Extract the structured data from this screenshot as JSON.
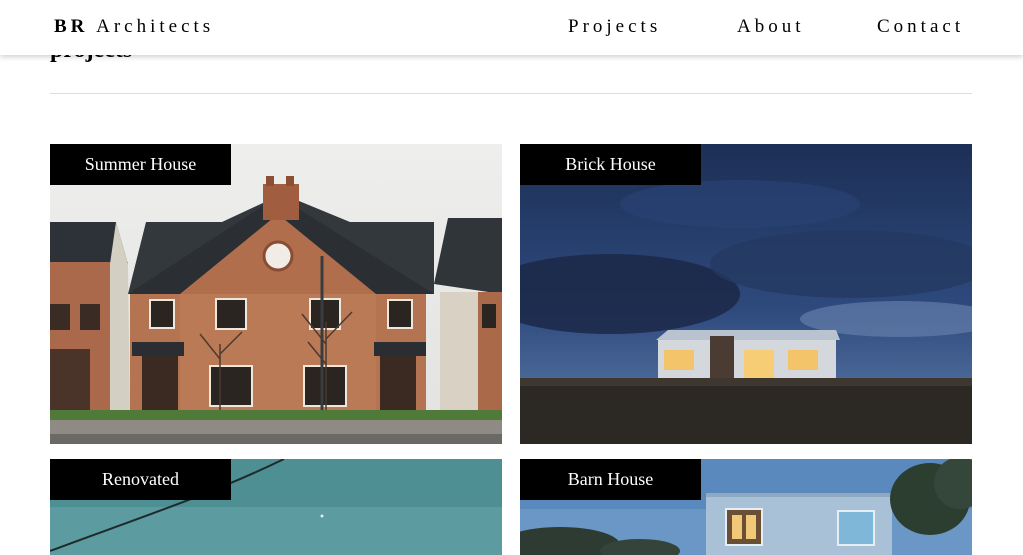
{
  "header": {
    "brand_initials": "BR",
    "brand_name": "Architects",
    "nav": [
      {
        "label": "Projects"
      },
      {
        "label": "About"
      },
      {
        "label": "Contact"
      }
    ]
  },
  "main": {
    "section_title": "projects",
    "projects": [
      {
        "label": "Summer House"
      },
      {
        "label": "Brick House"
      },
      {
        "label": "Renovated"
      },
      {
        "label": "Barn House"
      }
    ]
  },
  "colors": {
    "label_background": "#000000",
    "label_text": "#ffffff",
    "divider": "#dddddd"
  }
}
